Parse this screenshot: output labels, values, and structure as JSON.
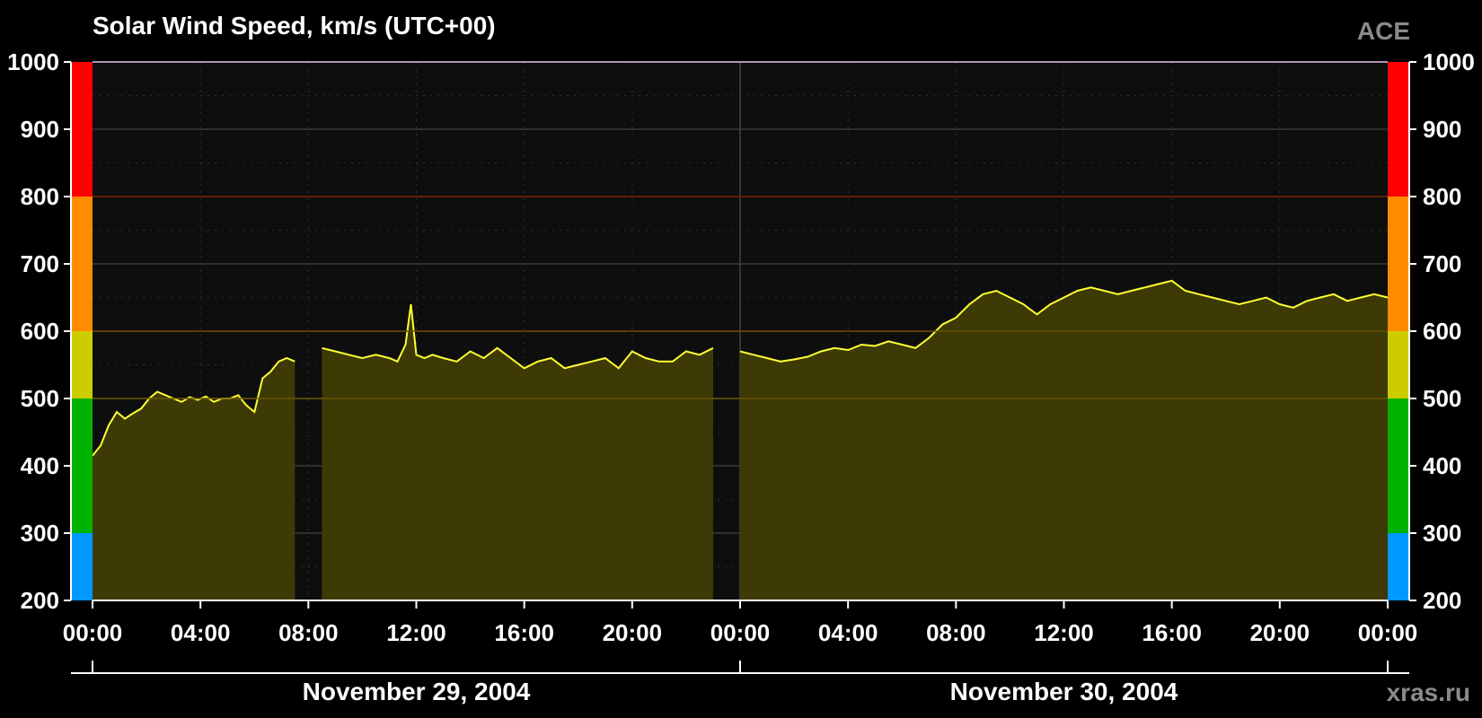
{
  "chart_data": {
    "type": "area",
    "title": "Solar Wind Speed, km/s (UTC+00)",
    "source_label": "ACE",
    "watermark": "xras.ru",
    "ylim": [
      200,
      1000
    ],
    "yticks": [
      200,
      300,
      400,
      500,
      600,
      700,
      800,
      900,
      1000
    ],
    "x_range_hours": [
      0,
      48
    ],
    "xtick_hours": [
      0,
      4,
      8,
      12,
      16,
      20,
      24,
      28,
      32,
      36,
      40,
      44,
      48
    ],
    "xtick_labels": [
      "00:00",
      "04:00",
      "08:00",
      "12:00",
      "16:00",
      "20:00",
      "00:00",
      "04:00",
      "08:00",
      "12:00",
      "16:00",
      "20:00",
      "00:00"
    ],
    "date_labels": [
      {
        "label": "November 29, 2004",
        "center_hour": 12
      },
      {
        "label": "November 30, 2004",
        "center_hour": 36
      }
    ],
    "grid": true,
    "line_color": "#ffff33",
    "fill_color": "#3d3a05",
    "plot_background": "#0e0e0e",
    "speed_bands": [
      {
        "from": 200,
        "to": 300,
        "color": "#0099ff"
      },
      {
        "from": 300,
        "to": 500,
        "color": "#00b300"
      },
      {
        "from": 500,
        "to": 600,
        "color": "#cccc00"
      },
      {
        "from": 600,
        "to": 800,
        "color": "#ff8c00"
      },
      {
        "from": 800,
        "to": 1000,
        "color": "#ff0000"
      }
    ],
    "threshold_lines": [
      {
        "value": 500,
        "color": "#6b5500"
      },
      {
        "value": 600,
        "color": "#6b4a00"
      },
      {
        "value": 800,
        "color": "#7a1a00"
      }
    ],
    "series": [
      {
        "x_hours": [
          0.0,
          0.3,
          0.6,
          0.9,
          1.2,
          1.5,
          1.8,
          2.1,
          2.4,
          2.7,
          3.0,
          3.3,
          3.6,
          3.9,
          4.2,
          4.5,
          4.8,
          5.1,
          5.4,
          5.7,
          6.0,
          6.3,
          6.6,
          6.9,
          7.2,
          7.5
        ],
        "values": [
          415,
          430,
          460,
          480,
          470,
          478,
          485,
          500,
          510,
          505,
          500,
          495,
          502,
          498,
          503,
          495,
          500,
          500,
          505,
          490,
          480,
          530,
          540,
          555,
          560,
          555
        ]
      },
      {
        "x_hours": [
          8.5,
          9.0,
          9.5,
          10.0,
          10.5,
          11.0,
          11.3,
          11.6,
          11.8,
          12.0,
          12.3,
          12.6,
          13.0,
          13.5,
          14.0,
          14.5,
          15.0,
          15.5,
          16.0,
          16.5,
          17.0,
          17.5,
          18.0,
          18.5,
          19.0,
          19.5,
          20.0,
          20.5,
          21.0,
          21.5,
          22.0,
          22.5,
          23.0
        ],
        "values": [
          575,
          570,
          565,
          560,
          565,
          560,
          555,
          580,
          640,
          565,
          560,
          565,
          560,
          555,
          570,
          560,
          575,
          560,
          545,
          555,
          560,
          545,
          550,
          555,
          560,
          545,
          570,
          560,
          555,
          555,
          570,
          565,
          575
        ]
      },
      {
        "x_hours": [
          24.0,
          24.5,
          25.0,
          25.5,
          26.0,
          26.5,
          27.0,
          27.5,
          28.0,
          28.5,
          29.0,
          29.5,
          30.0,
          30.5,
          31.0,
          31.5,
          32.0,
          32.5,
          33.0,
          33.5,
          34.0,
          34.5,
          35.0,
          35.5,
          36.0,
          36.5,
          37.0,
          37.5,
          38.0,
          38.5,
          39.0,
          39.5,
          40.0,
          40.5,
          41.0,
          41.5,
          42.0,
          42.5,
          43.0,
          43.5,
          44.0,
          44.5,
          45.0,
          45.5,
          46.0,
          46.5,
          47.0,
          47.5,
          48.0
        ],
        "values": [
          570,
          565,
          560,
          555,
          558,
          562,
          570,
          575,
          572,
          580,
          578,
          585,
          580,
          575,
          590,
          610,
          620,
          640,
          655,
          660,
          650,
          640,
          625,
          640,
          650,
          660,
          665,
          660,
          655,
          660,
          665,
          670,
          675,
          660,
          655,
          650,
          645,
          640,
          645,
          650,
          640,
          635,
          645,
          650,
          655,
          645,
          650,
          655,
          650
        ]
      }
    ]
  }
}
